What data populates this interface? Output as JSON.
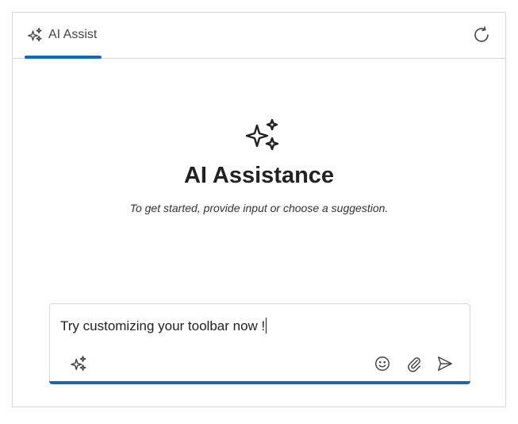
{
  "toolbar": {
    "tab": {
      "label": "AI Assist",
      "icon": "sparkle-icon",
      "active": true
    },
    "refresh_icon": "refresh-icon"
  },
  "hero": {
    "icon": "sparkle-icon",
    "title": "AI Assistance",
    "subtitle": "To get started, provide input or choose a suggestion."
  },
  "composer": {
    "value": "Try customizing your toolbar now !",
    "icons": {
      "left": "sparkle-icon",
      "emoji": "emoji-icon",
      "attach": "paperclip-icon",
      "send": "send-icon"
    }
  },
  "colors": {
    "accent": "#1a68a8",
    "border": "#d6d6d6",
    "text": "#222222"
  }
}
